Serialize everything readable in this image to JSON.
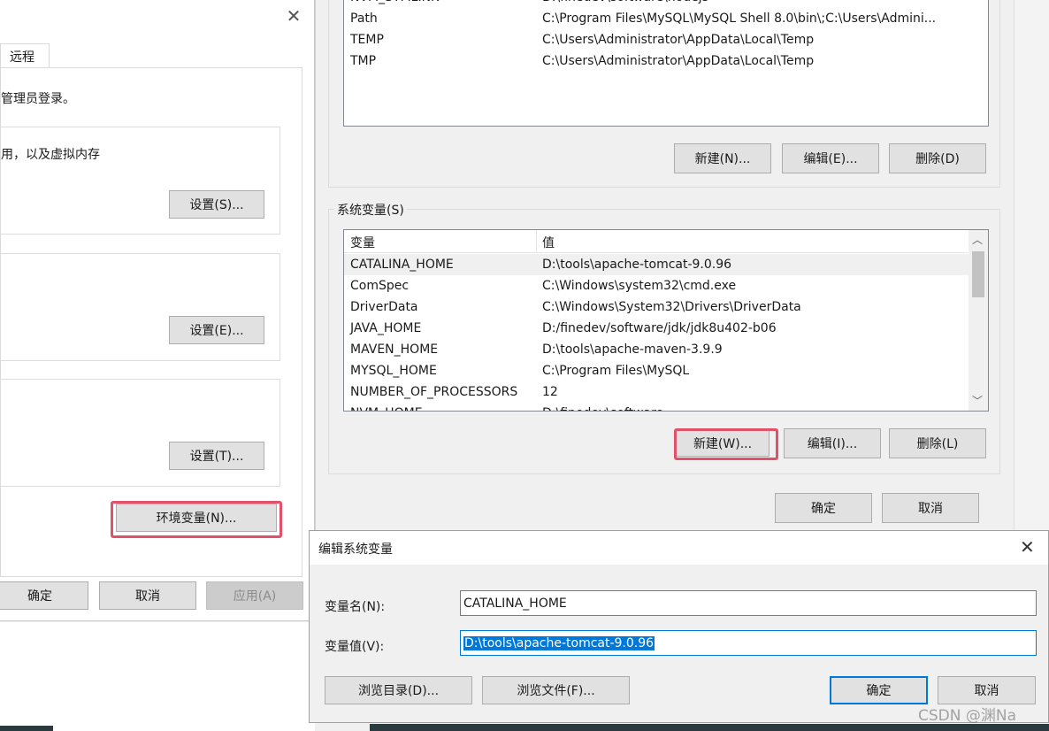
{
  "system_props": {
    "tab_remote": "远程",
    "admin_note": "管理员登录。",
    "perf_note": "用，以及虚拟内存",
    "settings_s": "设置(S)...",
    "settings_e": "设置(E)...",
    "settings_t": "设置(T)...",
    "env_button": "环境变量(N)...",
    "ok": "确定",
    "cancel": "取消",
    "apply": "应用(A)"
  },
  "env_dialog": {
    "user_vars": [
      {
        "name": "NVM_SYMLINK",
        "value": "D:\\finedev\\software\\nodejs"
      },
      {
        "name": "Path",
        "value": "C:\\Program Files\\MySQL\\MySQL Shell 8.0\\bin\\;C:\\Users\\Admini..."
      },
      {
        "name": "TEMP",
        "value": "C:\\Users\\Administrator\\AppData\\Local\\Temp"
      },
      {
        "name": "TMP",
        "value": "C:\\Users\\Administrator\\AppData\\Local\\Temp"
      }
    ],
    "user_new": "新建(N)...",
    "user_edit": "编辑(E)...",
    "user_delete": "删除(D)",
    "sys_group_label": "系统变量(S)",
    "col_var": "变量",
    "col_val": "值",
    "sys_vars": [
      {
        "name": "CATALINA_HOME",
        "value": "D:\\tools\\apache-tomcat-9.0.96"
      },
      {
        "name": "ComSpec",
        "value": "C:\\Windows\\system32\\cmd.exe"
      },
      {
        "name": "DriverData",
        "value": "C:\\Windows\\System32\\Drivers\\DriverData"
      },
      {
        "name": "JAVA_HOME",
        "value": "D:/finedev/software/jdk/jdk8u402-b06"
      },
      {
        "name": "MAVEN_HOME",
        "value": "D:\\tools\\apache-maven-3.9.9"
      },
      {
        "name": "MYSQL_HOME",
        "value": "C:\\Program Files\\MySQL"
      },
      {
        "name": "NUMBER_OF_PROCESSORS",
        "value": "12"
      },
      {
        "name": "NVM_HOME",
        "value": "D:\\finedev\\software"
      }
    ],
    "sys_new": "新建(W)...",
    "sys_edit": "编辑(I)...",
    "sys_delete": "删除(L)",
    "ok": "确定",
    "cancel": "取消"
  },
  "edit_dialog": {
    "title": "编辑系统变量",
    "name_label": "变量名(N):",
    "name_value": "CATALINA_HOME",
    "value_label": "变量值(V):",
    "value_value": "D:\\tools\\apache-tomcat-9.0.96",
    "browse_dir": "浏览目录(D)...",
    "browse_file": "浏览文件(F)...",
    "ok": "确定",
    "cancel": "取消"
  },
  "watermark": "CSDN @渊Na"
}
